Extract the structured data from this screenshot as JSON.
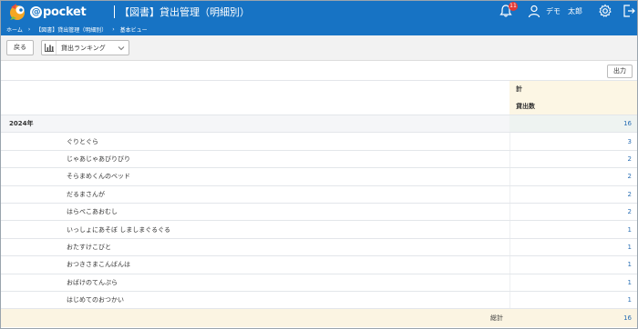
{
  "header": {
    "logo_text": "pocket",
    "logo_at": "@",
    "page_title": "【図書】貸出管理（明細別）",
    "notification_count": "11",
    "user_name": "デモ　太郎"
  },
  "breadcrumb": [
    "ホーム",
    "【図書】貸出管理（明細別）",
    "基本ビュー"
  ],
  "toolbar": {
    "back_label": "戻る",
    "view_selected": "貸出ランキング"
  },
  "export_label": "出力",
  "table": {
    "header_group": "計",
    "header_measure": "貸出数",
    "year_label": "2024年",
    "year_total": "16",
    "items": [
      {
        "title": "ぐりとぐら",
        "count": "3"
      },
      {
        "title": "じゃあじゃあびりびり",
        "count": "2"
      },
      {
        "title": "そらまめくんのベッド",
        "count": "2"
      },
      {
        "title": "だるまさんが",
        "count": "2"
      },
      {
        "title": "はらぺこあおむし",
        "count": "2"
      },
      {
        "title": "いっしょにあそぼ しましまぐるぐる",
        "count": "1"
      },
      {
        "title": "おたすけこびと",
        "count": "1"
      },
      {
        "title": "おつきさまこんばんは",
        "count": "1"
      },
      {
        "title": "おばけのてんぷら",
        "count": "1"
      },
      {
        "title": "はじめてのおつかい",
        "count": "1"
      }
    ],
    "grand_total_label": "総計",
    "grand_total": "16"
  },
  "colors": {
    "header_blue": "#1773c4",
    "badge_red": "#e53935",
    "value_blue": "#2a6fb5",
    "total_bg": "#fbf4e2"
  },
  "icons": [
    "logo-bird-icon",
    "bell-icon",
    "user-icon",
    "gear-icon",
    "logout-icon",
    "bar-chart-icon",
    "chevron-down-icon"
  ]
}
